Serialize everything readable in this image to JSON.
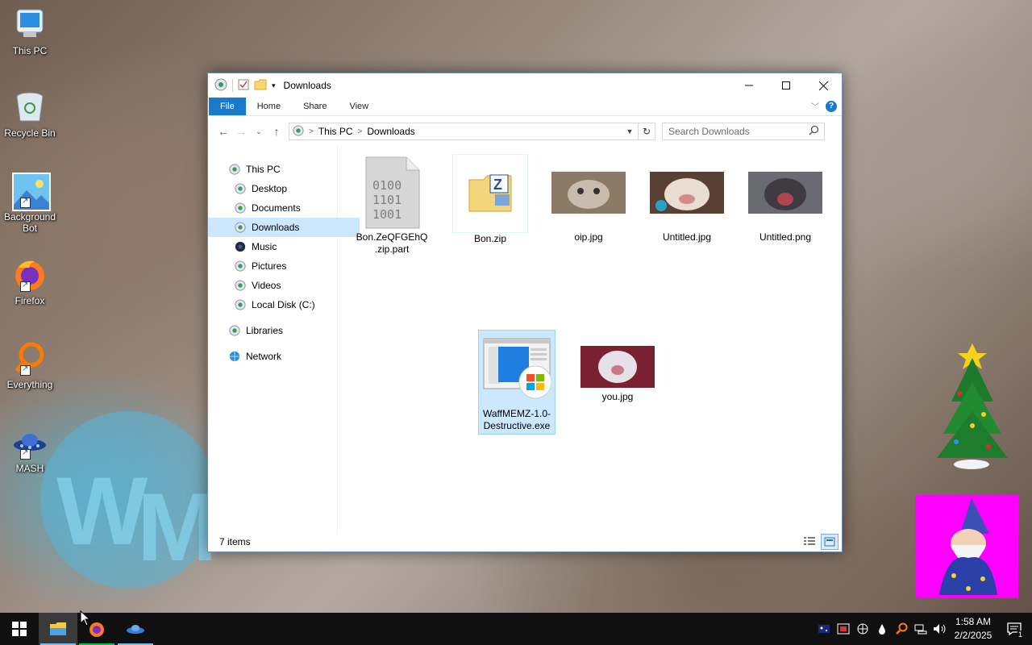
{
  "desktop": {
    "icons": [
      {
        "label": "This PC"
      },
      {
        "label": "Recycle Bin"
      },
      {
        "label": "Background Bot"
      },
      {
        "label": "Firefox"
      },
      {
        "label": "Everything"
      },
      {
        "label": "MASH"
      }
    ]
  },
  "window": {
    "title": "Downloads",
    "ribbon_tabs": [
      "File",
      "Home",
      "Share",
      "View"
    ],
    "help_label": "?",
    "address": {
      "segments": [
        "This PC",
        "Downloads"
      ]
    },
    "search": {
      "placeholder": "Search Downloads"
    },
    "nav_pane": {
      "this_pc": "This PC",
      "children": [
        "Desktop",
        "Documents",
        "Downloads",
        "Music",
        "Pictures",
        "Videos",
        "Local Disk (C:)"
      ],
      "libraries": "Libraries",
      "network": "Network",
      "selected": "Downloads"
    },
    "files": [
      {
        "name": "Bon.ZeQFGEhQ.zip.part",
        "type": "binary-file"
      },
      {
        "name": "Bon.zip",
        "type": "zip-archive"
      },
      {
        "name": "oip.jpg",
        "type": "image"
      },
      {
        "name": "Untitled.jpg",
        "type": "image"
      },
      {
        "name": "Untitled.png",
        "type": "image"
      },
      {
        "name": "WaffMEMZ-1.0-Destructive.exe",
        "type": "executable",
        "selected": true
      },
      {
        "name": "you.jpg",
        "type": "image"
      }
    ],
    "binary_text": [
      "0100",
      "1101",
      "1001"
    ],
    "status": "7 items"
  },
  "taskbar": {
    "apps": [
      "File Explorer",
      "Firefox",
      "MASH"
    ],
    "clock": {
      "time": "1:58 AM",
      "date": "2/2/2025"
    },
    "notification_count": "1"
  },
  "colors": {
    "accent": "#1979ca",
    "selection": "#cce8ff",
    "taskbar": "#101010",
    "wizard_bg": "#ff00ff"
  }
}
